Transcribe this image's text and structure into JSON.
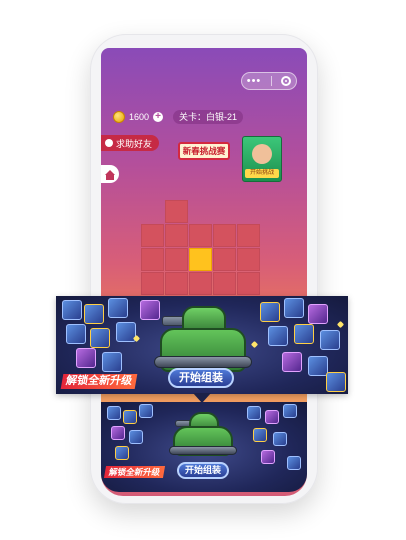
{
  "header": {
    "coins": "1600",
    "coin_plus": "+",
    "level_text": "关卡：白银-21",
    "capsule_dots": "•••"
  },
  "buttons": {
    "help_friend": "求助好友",
    "newbie_battle": "新春挑战赛",
    "gift_label": "开始挑战",
    "start_assemble": "开始组装"
  },
  "banner": {
    "upgrade_text": "解锁全新升级"
  },
  "icons": [
    "coin-icon",
    "plus-icon",
    "capsule-dots-icon",
    "target-icon",
    "friend-icon",
    "home-icon",
    "hand-icon",
    "tank-icon"
  ],
  "colors": {
    "accent_red": "#c62a45",
    "highlight_yellow": "#ffc21e",
    "banner_bg": "#20275a",
    "start_button": "#2b3f96"
  }
}
